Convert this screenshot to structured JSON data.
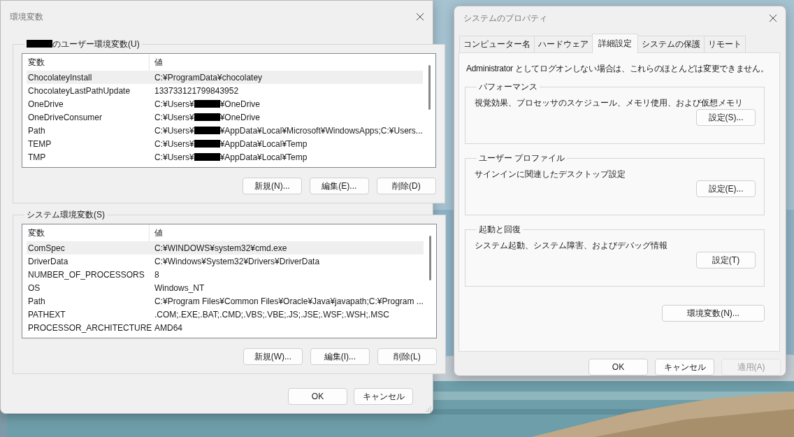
{
  "env_window": {
    "title": "環境変数",
    "sections": [
      {
        "title": "のユーザー環境変数(U)",
        "title_redacted": true,
        "columns": [
          "変数",
          "値"
        ],
        "rows": [
          {
            "name": "ChocolateyInstall",
            "value": [
              "C:¥ProgramData¥chocolatey"
            ],
            "selected": true
          },
          {
            "name": "ChocolateyLastPathUpdate",
            "value": [
              "133733121799843952"
            ],
            "selected": false
          },
          {
            "name": "OneDrive",
            "value": [
              "C:¥Users¥",
              "¥OneDrive"
            ],
            "selected": false
          },
          {
            "name": "OneDriveConsumer",
            "value": [
              "C:¥Users¥",
              "¥OneDrive"
            ],
            "selected": false
          },
          {
            "name": "Path",
            "value": [
              "C:¥Users¥",
              "¥AppData¥Local¥Microsoft¥WindowsApps;C:¥Users..."
            ],
            "selected": false
          },
          {
            "name": "TEMP",
            "value": [
              "C:¥Users¥",
              "¥AppData¥Local¥Temp"
            ],
            "selected": false
          },
          {
            "name": "TMP",
            "value": [
              "C:¥Users¥",
              "¥AppData¥Local¥Temp"
            ],
            "selected": false
          }
        ],
        "buttons": [
          "新規(N)...",
          "編集(E)...",
          "削除(D)"
        ]
      },
      {
        "title": "システム環境変数(S)",
        "title_redacted": false,
        "columns": [
          "変数",
          "値"
        ],
        "rows": [
          {
            "name": "ComSpec",
            "value": [
              "C:¥WINDOWS¥system32¥cmd.exe"
            ],
            "selected": true
          },
          {
            "name": "DriverData",
            "value": [
              "C:¥Windows¥System32¥Drivers¥DriverData"
            ],
            "selected": false
          },
          {
            "name": "NUMBER_OF_PROCESSORS",
            "value": [
              "8"
            ],
            "selected": false
          },
          {
            "name": "OS",
            "value": [
              "Windows_NT"
            ],
            "selected": false
          },
          {
            "name": "Path",
            "value": [
              "C:¥Program Files¥Common Files¥Oracle¥Java¥javapath;C:¥Program ..."
            ],
            "selected": false
          },
          {
            "name": "PATHEXT",
            "value": [
              ".COM;.EXE;.BAT;.CMD;.VBS;.VBE;.JS;.JSE;.WSF;.WSH;.MSC"
            ],
            "selected": false
          },
          {
            "name": "PROCESSOR_ARCHITECTURE",
            "value": [
              "AMD64"
            ],
            "selected": false
          }
        ],
        "buttons": [
          "新規(W)...",
          "編集(I)...",
          "削除(L)"
        ]
      }
    ],
    "buttons": [
      "OK",
      "キャンセル"
    ]
  },
  "props_window": {
    "title": "システムのプロパティ",
    "tabs": [
      {
        "label": "コンピューター名",
        "selected": false
      },
      {
        "label": "ハードウェア",
        "selected": false
      },
      {
        "label": "詳細設定",
        "selected": true
      },
      {
        "label": "システムの保護",
        "selected": false
      },
      {
        "label": "リモート",
        "selected": false
      }
    ],
    "notice": "Administrator としてログオンしない場合は、これらのほとんどは変更できません。",
    "groups": [
      {
        "title": "パフォーマンス",
        "description": "視覚効果、プロセッサのスケジュール、メモリ使用、および仮想メモリ",
        "button": "設定(S)..."
      },
      {
        "title": "ユーザー プロファイル",
        "description": "サインインに関連したデスクトップ設定",
        "button": "設定(E)..."
      },
      {
        "title": "起動と回復",
        "description": "システム起動、システム障害、およびデバッグ情報",
        "button": "設定(T)"
      }
    ],
    "env_button": "環境変数(N)...",
    "buttons": [
      {
        "label": "OK",
        "disabled": false
      },
      {
        "label": "キャンセル",
        "disabled": false
      },
      {
        "label": "適用(A)",
        "disabled": true
      }
    ]
  }
}
